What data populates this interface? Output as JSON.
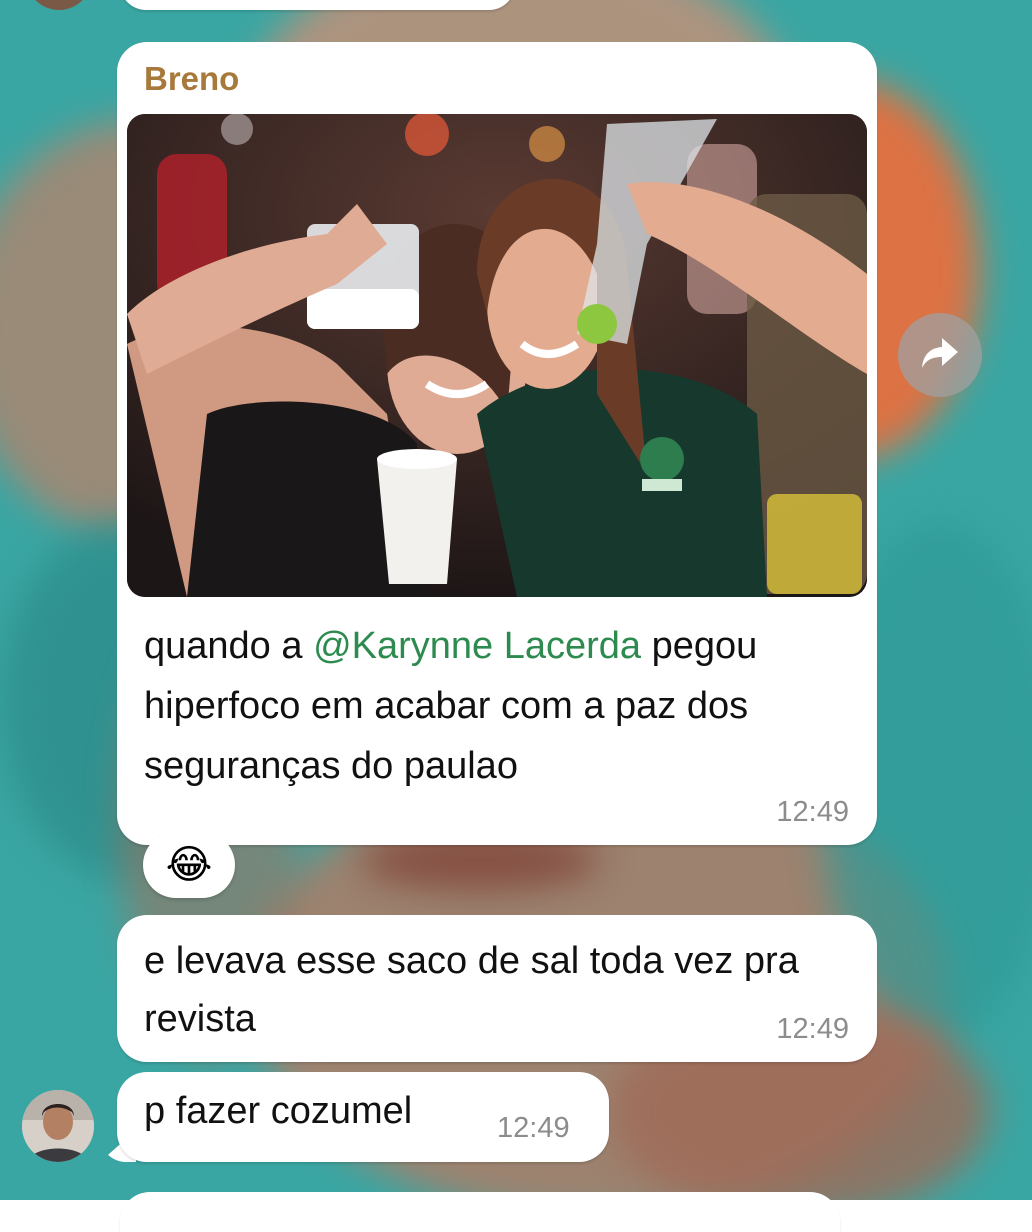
{
  "messages": [
    {
      "sender": "Breno",
      "caption_prefix": "quando a ",
      "mention": "@Karynne Lacerda",
      "caption_rest": "pegou hiperfoco em acabar com a paz dos seguranças do paulao",
      "time": "12:49",
      "reaction": "😂"
    },
    {
      "text": "e levava esse saco de sal toda vez pra revista",
      "time": "12:49"
    },
    {
      "text": "p fazer cozumel",
      "time": "12:49"
    }
  ],
  "icons": {
    "forward": "forward-arrow-icon"
  },
  "colors": {
    "sender_name": "#a7793b",
    "mention": "#2e8b4f",
    "bubble": "#ffffff",
    "timestamp": "#8c8c8c",
    "wallpaper": "#3aa6a3"
  }
}
